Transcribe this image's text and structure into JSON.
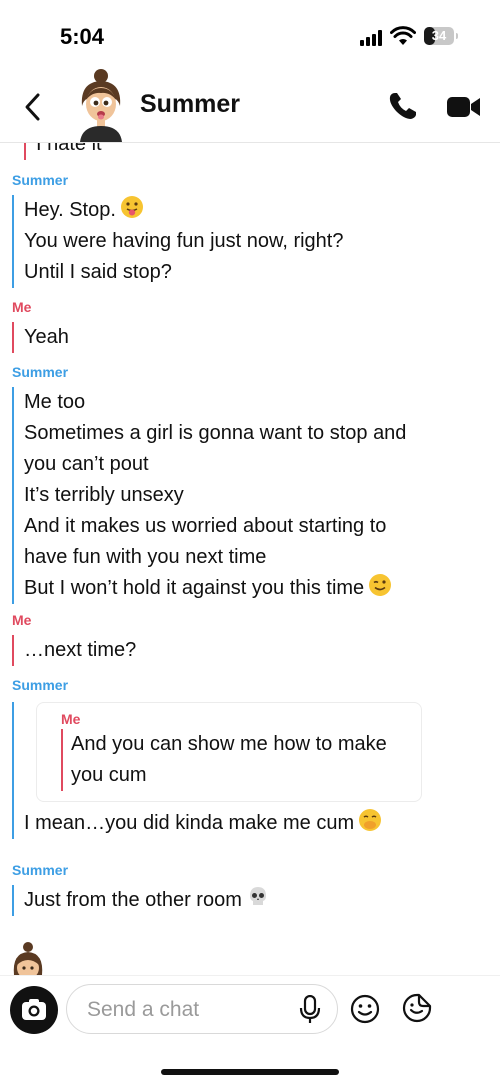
{
  "status_bar": {
    "time": "5:04",
    "battery": "34"
  },
  "header": {
    "title": "Summer"
  },
  "chat": {
    "partial_line": "I hate it",
    "messages": [
      {
        "sender": "Summer",
        "lines": [
          "Hey. Stop.",
          "You were having fun just now, right?",
          "Until I said stop?"
        ]
      },
      {
        "sender": "Me",
        "lines": [
          "Yeah"
        ]
      },
      {
        "sender": "Summer",
        "lines": [
          "Me too",
          "Sometimes a girl is gonna want to stop and",
          "you can’t pout",
          "It’s terribly unsexy",
          "And it makes us worried about starting to",
          "have fun with you next time",
          "But I won’t hold it against you this time"
        ]
      },
      {
        "sender": "Me",
        "lines": [
          "…next time?"
        ]
      },
      {
        "sender": "Summer",
        "quote": {
          "sender": "Me",
          "lines": [
            "And you can show me how to make",
            "you cum"
          ]
        },
        "lines": [
          "I mean…you did kinda make me cum"
        ]
      },
      {
        "sender": "Summer",
        "lines": [
          "Just from the other room"
        ]
      }
    ]
  },
  "input": {
    "placeholder": "Send a chat"
  },
  "icons": {
    "back": "chevron-left-icon",
    "phone": "phone-icon",
    "video": "video-camera-icon",
    "camera": "camera-icon",
    "mic": "microphone-icon",
    "smile": "smiley-icon",
    "sticker": "sticker-icon"
  },
  "colors": {
    "summer": "#3d9ee4",
    "me": "#e04a5f"
  }
}
